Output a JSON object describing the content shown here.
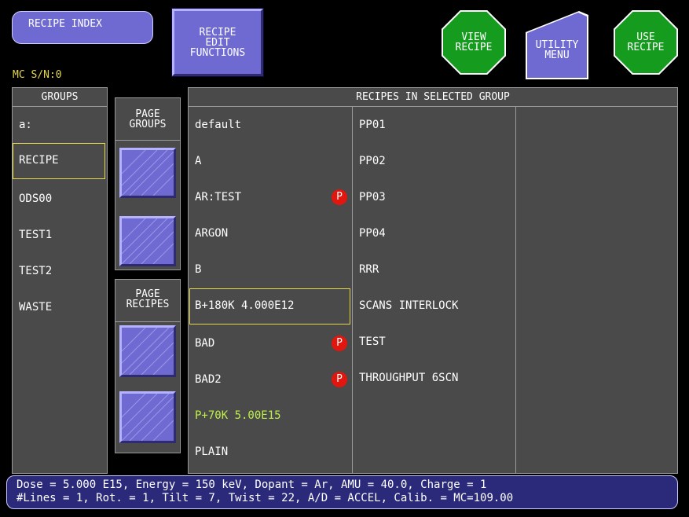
{
  "top": {
    "recipe_index": "RECIPE INDEX",
    "recipe_edit_functions": "RECIPE\nEDIT\nFUNCTIONS",
    "view_recipe": "VIEW\nRECIPE",
    "utility_menu": "UTILITY\nMENU",
    "use_recipe": "USE\nRECIPE",
    "mc_serial": "MC S/N:0"
  },
  "groups": {
    "header": "GROUPS",
    "items": [
      "a:",
      "RECIPE",
      "ODS00",
      "TEST1",
      "TEST2",
      "WASTE"
    ],
    "selected": "RECIPE"
  },
  "page_groups_label": "PAGE\nGROUPS",
  "page_recipes_label": "PAGE\nRECIPES",
  "recipes": {
    "header": "RECIPES IN SELECTED GROUP",
    "col1": [
      "default",
      "A",
      "AR:TEST",
      "ARGON",
      "B",
      "B+180K 4.000E12",
      "BAD",
      "BAD2",
      "P+70K 5.00E15",
      "PLAIN"
    ],
    "col2": [
      "PP01",
      "PP02",
      "PP03",
      "PP04",
      "RRR",
      "SCANS INTERLOCK",
      "TEST",
      "THROUGHPUT 6SCN"
    ],
    "badge_label": "P",
    "selected": "B+180K 4.000E12",
    "highlighted": "P+70K 5.00E15"
  },
  "status": {
    "line1": "Dose = 5.000 E15, Energy = 150 keV, Dopant = Ar, AMU = 40.0, Charge = 1",
    "line2": "#Lines = 1, Rot. = 1, Tilt = 7, Twist = 22, A/D = ACCEL, Calib. = MC=109.00"
  },
  "colors": {
    "accent": "#6f6ad1",
    "panel": "#4a4a4a",
    "go_green": "#159c1f",
    "badge_red": "#e0160f",
    "select_yellow": "#e5d84a",
    "highlight_green": "#bff04a"
  }
}
